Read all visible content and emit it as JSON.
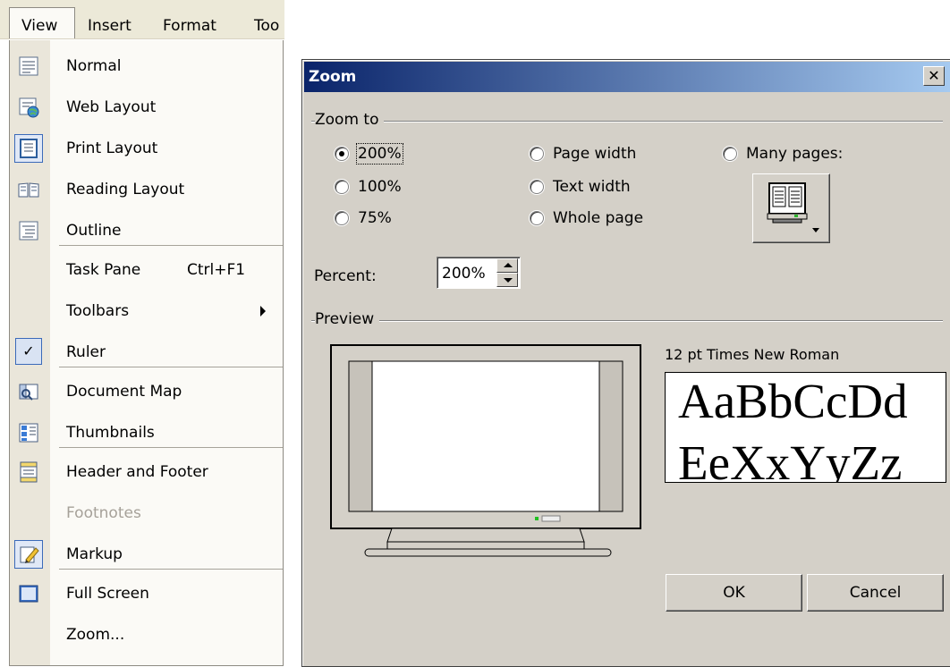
{
  "menubar": {
    "view": "View",
    "insert": "Insert",
    "format": "Format",
    "tools": "Too"
  },
  "view_menu": {
    "items": [
      {
        "label": "Normal",
        "icon": "normal-view-icon"
      },
      {
        "label": "Web Layout",
        "icon": "web-layout-icon"
      },
      {
        "label": "Print Layout",
        "icon": "print-layout-icon",
        "checked": true
      },
      {
        "label": "Reading Layout",
        "icon": "reading-layout-icon"
      },
      {
        "label": "Outline",
        "icon": "outline-icon"
      },
      {
        "label": "Task Pane",
        "shortcut": "Ctrl+F1"
      },
      {
        "label": "Toolbars",
        "submenu": true
      },
      {
        "label": "Ruler",
        "icon": "checkmark-icon",
        "checked": true
      },
      {
        "label": "Document Map",
        "icon": "document-map-icon"
      },
      {
        "label": "Thumbnails",
        "icon": "thumbnails-icon"
      },
      {
        "label": "Header and Footer",
        "icon": "header-footer-icon"
      },
      {
        "label": "Footnotes",
        "disabled": true
      },
      {
        "label": "Markup",
        "icon": "markup-icon",
        "checked": true
      },
      {
        "label": "Full Screen",
        "icon": "full-screen-icon"
      },
      {
        "label": "Zoom..."
      }
    ]
  },
  "zoom_dialog": {
    "title": "Zoom",
    "zoom_to_label": "Zoom to",
    "options": {
      "p200": "200%",
      "p100": "100%",
      "p75": "75%",
      "page_width": "Page width",
      "text_width": "Text width",
      "whole_page": "Whole page",
      "many_pages": "Many pages:"
    },
    "selected_option": "200%",
    "percent_label": "Percent:",
    "percent_value": "200%",
    "preview_label": "Preview",
    "font_caption": "12 pt Times New Roman",
    "sample_line_1": "AaBbCcDd",
    "sample_line_2": "EeXxYyZz",
    "ok_label": "OK",
    "cancel_label": "Cancel"
  },
  "colors": {
    "title_start": "#0a246a",
    "title_end": "#a6caf0",
    "dialog_face": "#d4d0c8",
    "menu_face": "#fbfaf6"
  }
}
